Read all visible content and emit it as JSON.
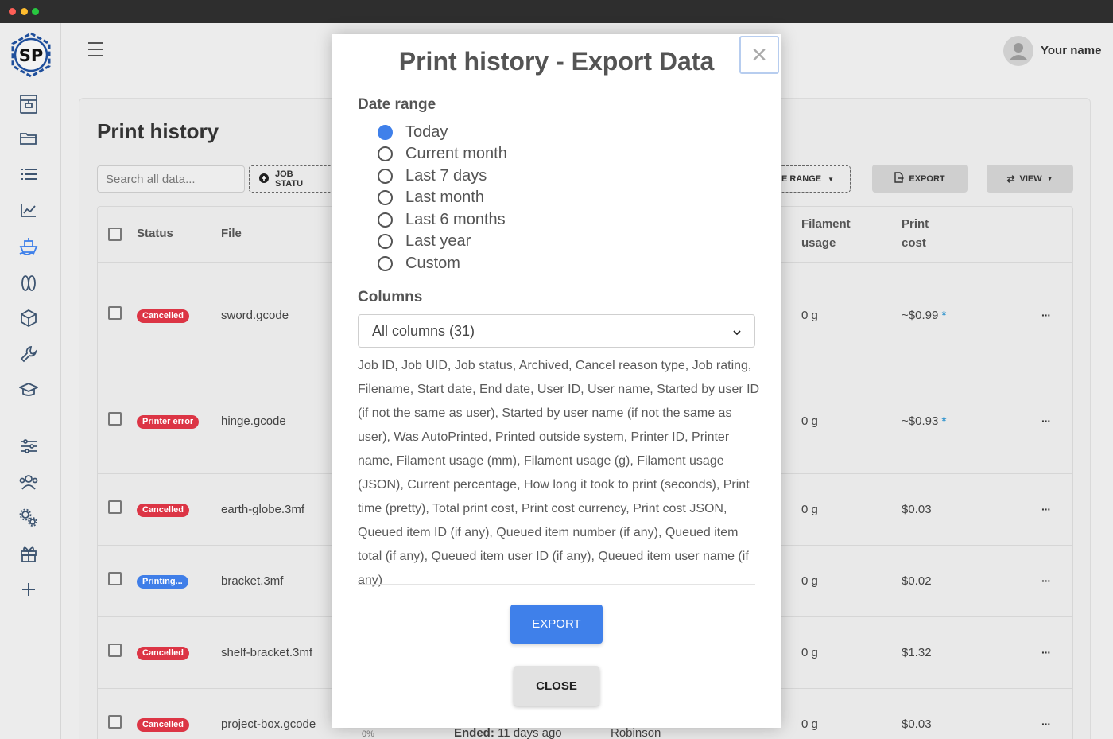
{
  "sidebar": {
    "logo_text": "SP",
    "icons": [
      "printer-icon",
      "folder-icon",
      "list-icon",
      "chart-icon",
      "ship-icon",
      "spool-icon",
      "box-icon",
      "wrench-icon",
      "graduation-cap-icon",
      "sliders-icon",
      "users-icon",
      "gears-icon",
      "gift-icon",
      "plus-icon"
    ]
  },
  "header": {
    "user_name": "Your name"
  },
  "page": {
    "title": "Print history",
    "search_placeholder": "Search all data...",
    "job_status_label": "JOB STATU",
    "date_range_label": "E RANGE",
    "export_label": "EXPORT",
    "view_label": "VIEW"
  },
  "table": {
    "headers": {
      "status": "Status",
      "file": "File",
      "filament_1": "Filament",
      "filament_2": "usage",
      "cost_1": "Print",
      "cost_2": "cost"
    },
    "rows": [
      {
        "status": "Cancelled",
        "status_color": "red",
        "file": "sword.gcode",
        "filament": "0 g",
        "cost": "~$0.99",
        "asterisk": "*"
      },
      {
        "status": "Printer error",
        "status_color": "red",
        "file": "hinge.gcode",
        "filament": "0 g",
        "cost": "~$0.93",
        "asterisk": "*"
      },
      {
        "status": "Cancelled",
        "status_color": "red",
        "file": "earth-globe.3mf",
        "filament": "0 g",
        "cost": "$0.03",
        "asterisk": ""
      },
      {
        "status": "Printing...",
        "status_color": "blue",
        "file": "bracket.3mf",
        "filament": "0 g",
        "cost": "$0.02",
        "asterisk": ""
      },
      {
        "status": "Cancelled",
        "status_color": "red",
        "file": "shelf-bracket.3mf",
        "filament": "0 g",
        "cost": "$1.32",
        "asterisk": ""
      },
      {
        "status": "Cancelled",
        "status_color": "red",
        "file": "project-box.gcode",
        "filament": "0 g",
        "cost": "$0.03",
        "asterisk": ""
      }
    ],
    "partial_row": {
      "percent": "0%",
      "ended_label": "Ended:",
      "ended_value": "11 days ago",
      "user": "Robinson"
    },
    "menu_glyph": "···"
  },
  "modal": {
    "title": "Print history - Export Data",
    "close_glyph": "×",
    "date_range_label": "Date range",
    "date_options": [
      "Today",
      "Current month",
      "Last 7 days",
      "Last month",
      "Last 6 months",
      "Last year",
      "Custom"
    ],
    "selected_option": "Today",
    "columns_label": "Columns",
    "columns_select_value": "All columns (31)",
    "columns_description": "Job ID, Job UID, Job status, Archived, Cancel reason type, Job rating, Filename, Start date, End date, User ID, User name, Started by user ID (if not the same as user), Started by user name (if not the same as user), Was AutoPrinted, Printed outside system, Printer ID, Printer name, Filament usage (mm), Filament usage (g), Filament usage (JSON), Current percentage, How long it took to print (seconds), Print time (pretty), Total print cost, Print cost currency, Print cost JSON, Queued item ID (if any), Queued item number (if any), Queued item total (if any), Queued item user ID (if any), Queued item user name (if any)",
    "export_button": "EXPORT",
    "close_button": "CLOSE"
  },
  "colors": {
    "accent": "#3f80ea",
    "danger": "#dc3545",
    "asterisk": "#3f9bd0"
  }
}
